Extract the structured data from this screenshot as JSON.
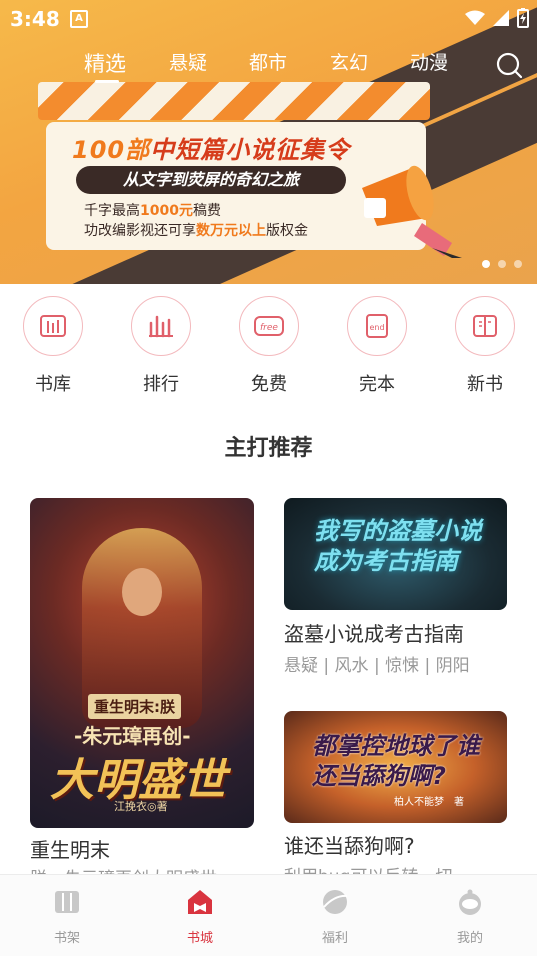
{
  "status": {
    "time": "3:48"
  },
  "tabs": [
    "精选",
    "悬疑",
    "都市",
    "玄幻",
    "动漫"
  ],
  "banner": {
    "title_num": "100部",
    "title_rest": "中短篇小说征集令",
    "subtitle": "从文字到荧屏的奇幻之旅",
    "line1_a": "千字最高",
    "line1_hl": "1000元",
    "line1_b": "稿费",
    "line2_a": "功改编影视还可享",
    "line2_hl": "数万元以上",
    "line2_b": "版权金"
  },
  "categories": [
    "书库",
    "排行",
    "免费",
    "完本",
    "新书"
  ],
  "section_title": "主打推荐",
  "main_book": {
    "cover_small": "重生明末:朕",
    "cover_mid": "-朱元璋再创-",
    "cover_big": "大明盛世",
    "cover_author": "江挽衣◎著",
    "title": "重生明末",
    "desc": "朕，朱元璋再创大明盛世"
  },
  "side_books": [
    {
      "cover_text": "我写的盗墓小说成为考古指南",
      "title": "盗墓小说成考古指南",
      "tags": "悬疑 | 风水 | 惊悚 | 阴阳"
    },
    {
      "cover_text": "都掌控地球了谁还当舔狗啊?",
      "cover_author": "柏人不能梦　著",
      "title": "谁还当舔狗啊?",
      "desc": "利用bug可以反转一切"
    }
  ],
  "bottom_nav": [
    "书架",
    "书城",
    "福利",
    "我的"
  ],
  "colors": {
    "accent": "#d9343f",
    "banner": "#f3a541"
  }
}
